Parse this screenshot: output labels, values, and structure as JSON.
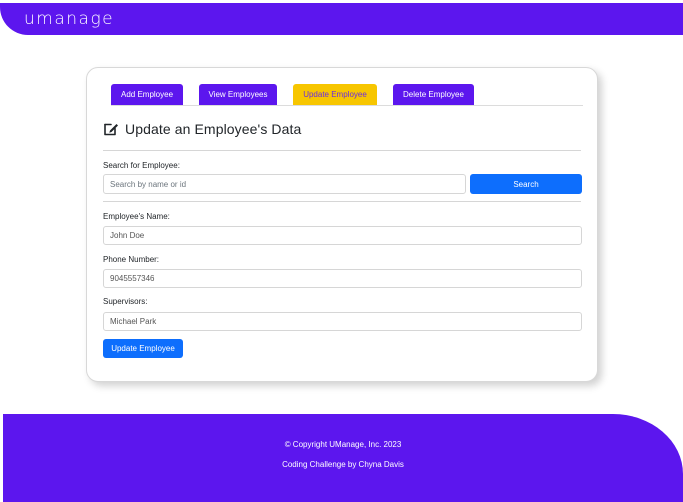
{
  "header": {
    "logo_text": "umanage"
  },
  "tabs": [
    {
      "label": "Add Employee"
    },
    {
      "label": "View Employees"
    },
    {
      "label": "Update Employee"
    },
    {
      "label": "Delete Employee"
    }
  ],
  "form": {
    "title": "Update an Employee's Data",
    "search_label": "Search for Employee:",
    "search_placeholder": "Search by name or id",
    "search_button": "Search",
    "name_label": "Employee's Name:",
    "name_value": "John Doe",
    "phone_label": "Phone Number:",
    "phone_value": "9045557346",
    "supervisors_label": "Supervisors:",
    "supervisors_value": "Michael Park",
    "submit_button": "Update Employee"
  },
  "footer": {
    "copyright": "© Copyright UManage, Inc. 2023",
    "credit": "Coding Challenge by Chyna Davis"
  },
  "colors": {
    "brand": "#5c16ee",
    "active_tab": "#f7c600",
    "primary_button": "#0d6efd"
  },
  "icons": {
    "title_icon": "edit-icon"
  }
}
